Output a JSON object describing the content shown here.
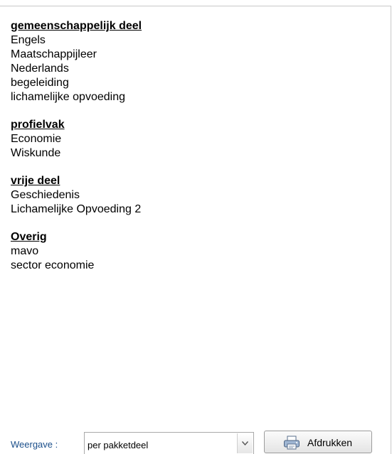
{
  "sections": [
    {
      "heading": "gemeenschappelijk deel",
      "items": [
        "Engels",
        "Maatschappijleer",
        "Nederlands",
        "begeleiding",
        "lichamelijke opvoeding"
      ]
    },
    {
      "heading": "profielvak",
      "items": [
        "Economie",
        "Wiskunde"
      ]
    },
    {
      "heading": "vrije deel",
      "items": [
        "Geschiedenis",
        "Lichamelijke Opvoeding 2"
      ]
    },
    {
      "heading": "Overig",
      "items": [
        "mavo",
        "sector economie"
      ]
    }
  ],
  "footer": {
    "view_label": "Weergave :",
    "view_select_value": "per pakketdeel",
    "print_button_label": "Afdrukken"
  },
  "icons": {
    "select_arrow": "chevron-down-icon",
    "print": "printer-icon"
  },
  "colors": {
    "view_label": "#1a4e8a"
  }
}
